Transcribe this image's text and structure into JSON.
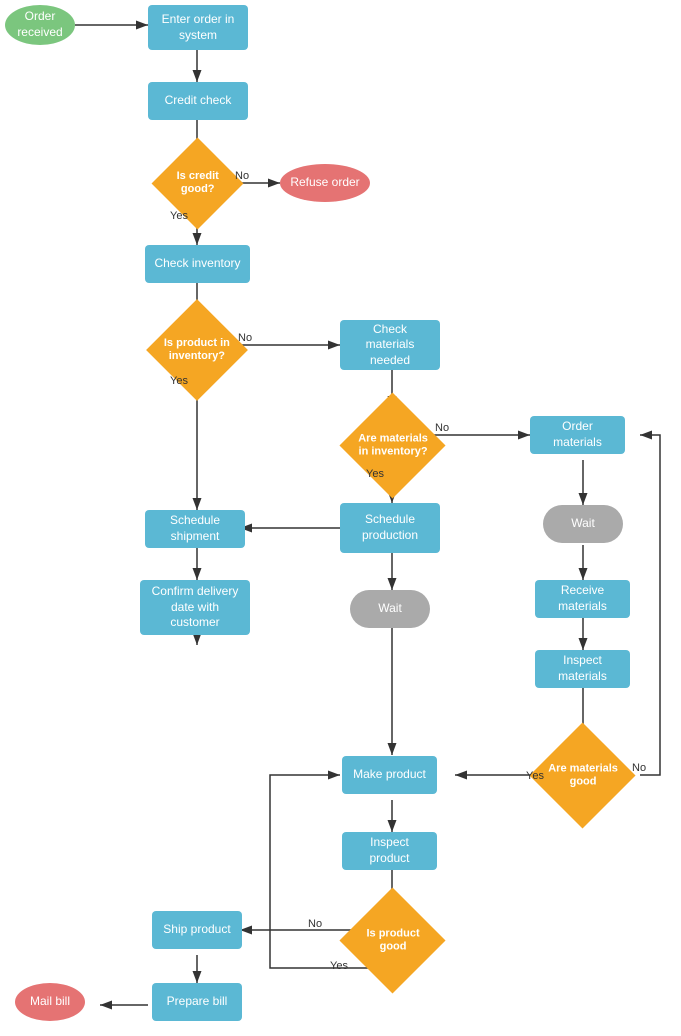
{
  "nodes": {
    "order_received": {
      "label": "Order received"
    },
    "enter_order": {
      "label": "Enter order in system"
    },
    "credit_check": {
      "label": "Credit check"
    },
    "is_credit_good": {
      "label": "Is credit good?"
    },
    "refuse_order": {
      "label": "Refuse order"
    },
    "check_inventory": {
      "label": "Check inventory"
    },
    "is_product_in_inventory": {
      "label": "Is product in inventory?"
    },
    "check_materials_needed": {
      "label": "Check materials needed"
    },
    "are_materials_in_inventory": {
      "label": "Are materials in inventory?"
    },
    "order_materials": {
      "label": "Order materials"
    },
    "wait1": {
      "label": "Wait"
    },
    "receive_materials": {
      "label": "Receive materials"
    },
    "inspect_materials": {
      "label": "Inspect materials"
    },
    "are_materials_good": {
      "label": "Are materials good"
    },
    "schedule_production": {
      "label": "Schedule production"
    },
    "wait2": {
      "label": "Wait"
    },
    "make_product": {
      "label": "Make product"
    },
    "inspect_product": {
      "label": "Inspect product"
    },
    "schedule_shipment": {
      "label": "Schedule shipment"
    },
    "is_product_good": {
      "label": "Is product good"
    },
    "ship_product": {
      "label": "Ship product"
    },
    "confirm_delivery": {
      "label": "Confirm delivery date with customer"
    },
    "prepare_bill": {
      "label": "Prepare bill"
    },
    "mail_bill": {
      "label": "Mail bill"
    }
  },
  "labels": {
    "no": "No",
    "yes": "Yes"
  }
}
